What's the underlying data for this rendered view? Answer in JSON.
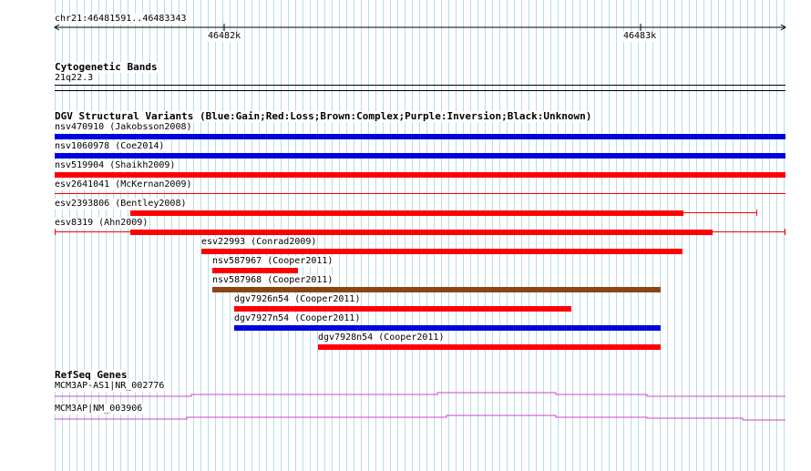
{
  "ruler": {
    "region": "chr21:46481591..46483343",
    "ticks": [
      "46482k",
      "46483k"
    ]
  },
  "cytoband": {
    "title": "Cytogenetic Bands",
    "band": "21q22.3"
  },
  "dgv": {
    "title": "DGV Structural Variants (Blue:Gain;Red:Loss;Brown:Complex;Purple:Inversion;Black:Unknown)",
    "colors": {
      "gain": "#0000dd",
      "loss": "#ff0000",
      "complex": "#8b4513",
      "inversion": "#800080",
      "unknown": "#000000"
    },
    "variants": [
      {
        "label": "nsv470910 (Jakobsson2008)",
        "type": "gain"
      },
      {
        "label": "nsv1060978 (Coe2014)",
        "type": "gain"
      },
      {
        "label": "nsv519904 (Shaikh2009)",
        "type": "loss"
      },
      {
        "label": "esv2641041 (McKernan2009)",
        "type": "loss"
      },
      {
        "label": "esv2393806 (Bentley2008)",
        "type": "loss"
      },
      {
        "label": "esv8319 (Ahn2009)",
        "type": "loss"
      },
      {
        "label": "esv22993 (Conrad2009)",
        "type": "loss"
      },
      {
        "label": "nsv587967 (Cooper2011)",
        "type": "loss"
      },
      {
        "label": "nsv587968 (Cooper2011)",
        "type": "complex"
      },
      {
        "label": "dgv7926n54 (Cooper2011)",
        "type": "loss"
      },
      {
        "label": "dgv7927n54 (Cooper2011)",
        "type": "gain"
      },
      {
        "label": "dgv7928n54 (Cooper2011)",
        "type": "loss"
      }
    ]
  },
  "refseq": {
    "title": "RefSeq Genes",
    "color": "#cc44cc",
    "genes": [
      {
        "label": "MCM3AP-AS1|NR_002776"
      },
      {
        "label": "MCM3AP|NM_003906"
      }
    ]
  }
}
